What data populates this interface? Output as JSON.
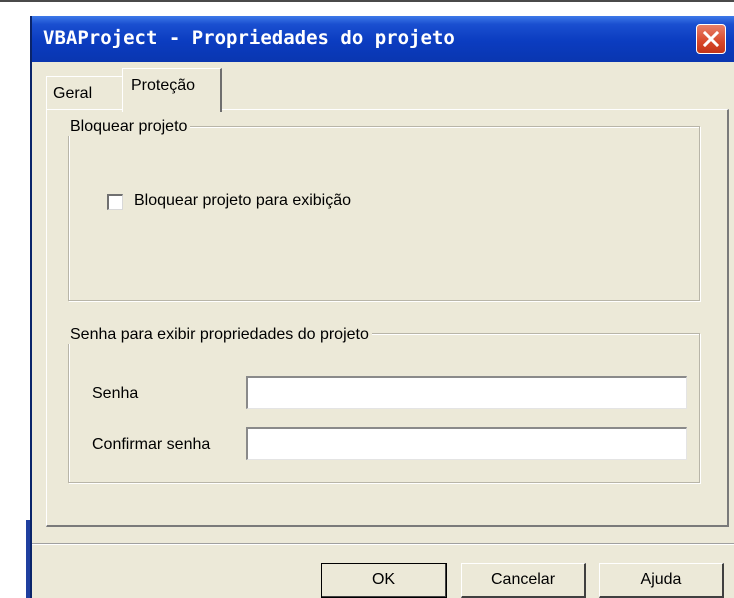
{
  "window": {
    "title": "VBAProject - Propriedades do projeto",
    "close_icon": "close-icon"
  },
  "tabs": [
    {
      "label": "Geral",
      "selected": false
    },
    {
      "label": "Proteção",
      "selected": true
    }
  ],
  "lock_group": {
    "legend": "Bloquear projeto",
    "checkbox_label": "Bloquear projeto para exibição",
    "checked": false
  },
  "password_group": {
    "legend": "Senha para exibir propriedades do projeto",
    "password_label": "Senha",
    "password_value": "",
    "confirm_label": "Confirmar senha",
    "confirm_value": ""
  },
  "buttons": {
    "ok": "OK",
    "cancel": "Cancelar",
    "help": "Ajuda"
  },
  "colors": {
    "titlebar": "#0a36b0",
    "dialog_bg": "#ece9d8",
    "close_button": "#d8482a"
  }
}
